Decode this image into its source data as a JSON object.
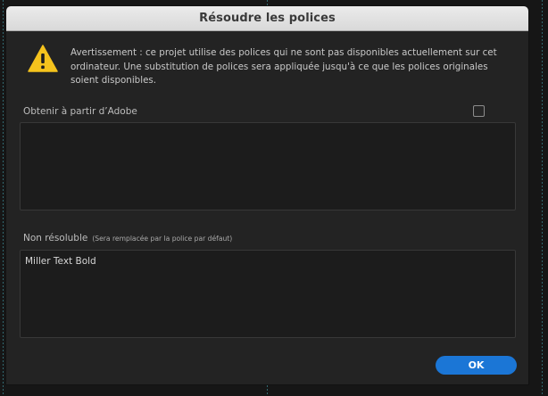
{
  "dialog": {
    "title": "Résoudre les polices",
    "warning": {
      "icon": "warning-icon",
      "text": "Avertissement : ce projet utilise des polices qui ne sont pas disponibles actuellement sur cet ordinateur. Une substitution de polices sera appliquée jusqu'à ce que les polices originales soient disponibles."
    },
    "adobe_section": {
      "label": "Obtenir à partir d’Adobe",
      "checked": false,
      "items": []
    },
    "unresolved_section": {
      "label": "Non résoluble",
      "note": "(Sera remplacée par la police par défaut)",
      "items": [
        "Miller Text Bold"
      ]
    },
    "ok_label": "OK"
  },
  "colors": {
    "accent": "#1b76d6",
    "warning_yellow": "#f5c31d",
    "dialog_bg": "#232323",
    "panel_bg": "#1c1c1c",
    "titlebar_bg": "#e3e3e3"
  }
}
